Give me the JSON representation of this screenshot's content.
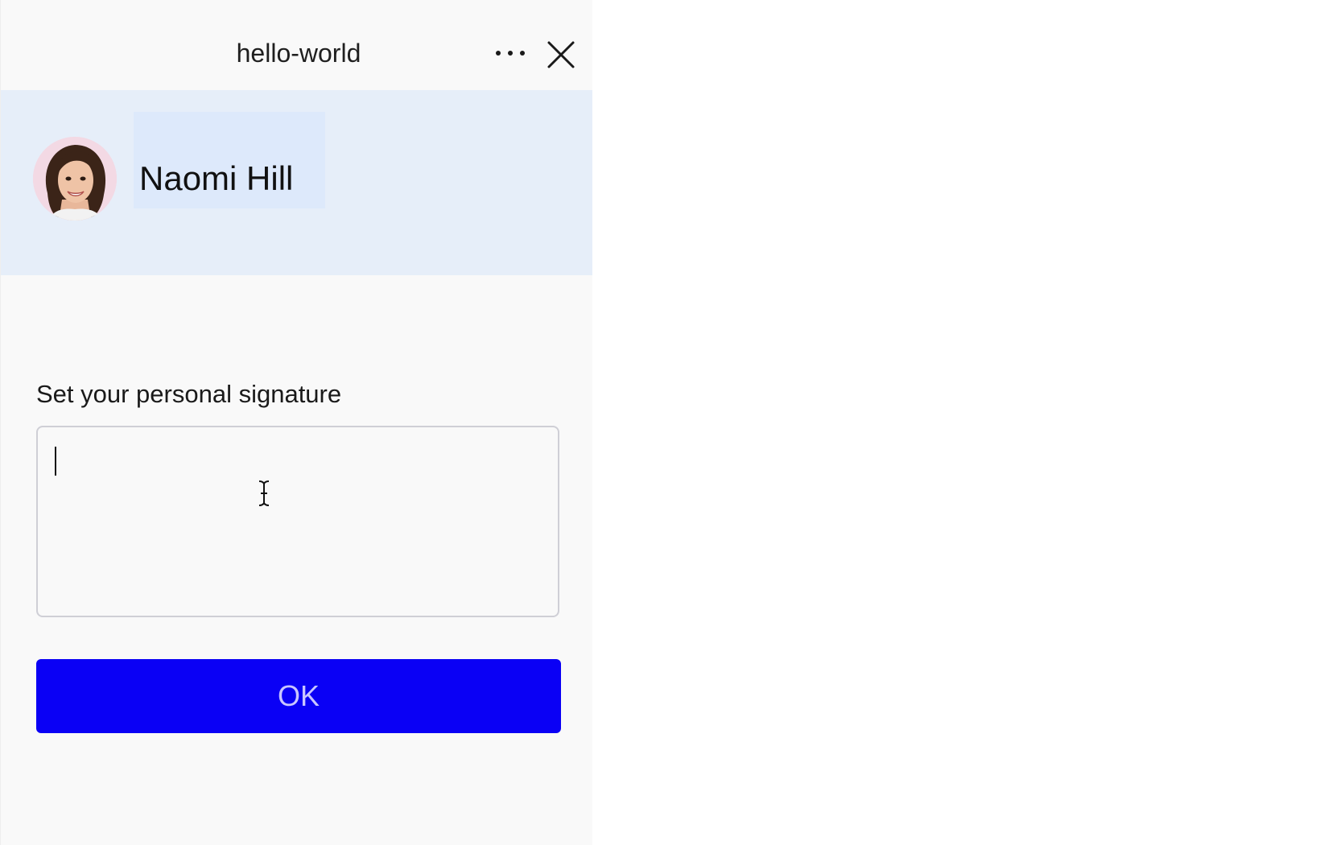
{
  "window": {
    "title": "hello-world",
    "more_icon": "more-horizontal-icon",
    "close_icon": "close-icon"
  },
  "profile": {
    "name": "Naomi Hill",
    "avatar_icon": "avatar-photo",
    "banner_color": "#e6eef9"
  },
  "signature": {
    "label": "Set your personal signature",
    "value": "",
    "placeholder": ""
  },
  "actions": {
    "ok_label": "OK",
    "ok_color": "#0a00f5"
  }
}
